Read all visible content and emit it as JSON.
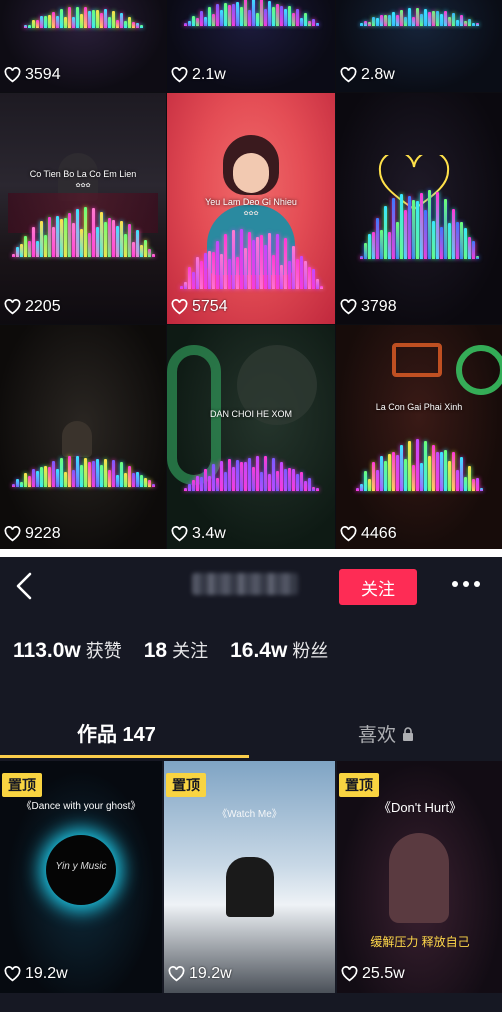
{
  "top_grid": {
    "cells": [
      {
        "likes": "3594",
        "title": "",
        "sub": ""
      },
      {
        "likes": "2.1w",
        "title": "",
        "sub": ""
      },
      {
        "likes": "2.8w",
        "title": "",
        "sub": ""
      },
      {
        "likes": "2205",
        "title": "Co Tien Bo La Co Em Lien",
        "sub": "✿✿✿"
      },
      {
        "likes": "5754",
        "title": "Yeu Lam Deo Gi Nhieu",
        "sub": "✿✿✿"
      },
      {
        "likes": "3798",
        "title": "",
        "sub": ""
      },
      {
        "likes": "9228",
        "title": "",
        "sub": ""
      },
      {
        "likes": "3.4w",
        "title": "DAN CHOI HE XOM",
        "sub": ""
      },
      {
        "likes": "4466",
        "title": "La Con Gai Phai Xinh",
        "sub": ""
      }
    ]
  },
  "profile": {
    "follow_label": "关注",
    "stats": [
      {
        "num": "113.0w",
        "label": "获赞"
      },
      {
        "num": "18",
        "label": "关注"
      },
      {
        "num": "16.4w",
        "label": "粉丝"
      }
    ],
    "tabs": {
      "works": "作品 147",
      "likes": "喜欢"
    },
    "videos": [
      {
        "pin": "置顶",
        "caption": "《Dance with your ghost》",
        "likes": "19.2w",
        "cover_text": "Yin y Music"
      },
      {
        "pin": "置顶",
        "caption": "《Watch Me》",
        "likes": "19.2w",
        "cover_text": ""
      },
      {
        "pin": "置顶",
        "caption": "《Don't Hurt》",
        "likes": "25.5w",
        "cover_text": "缓解压力 释放自己"
      }
    ]
  },
  "colors": {
    "accent_red": "#fe2c55",
    "pin_yellow": "#f9d441",
    "tab_underline": "#facd4b",
    "profile_bg": "#161823"
  }
}
